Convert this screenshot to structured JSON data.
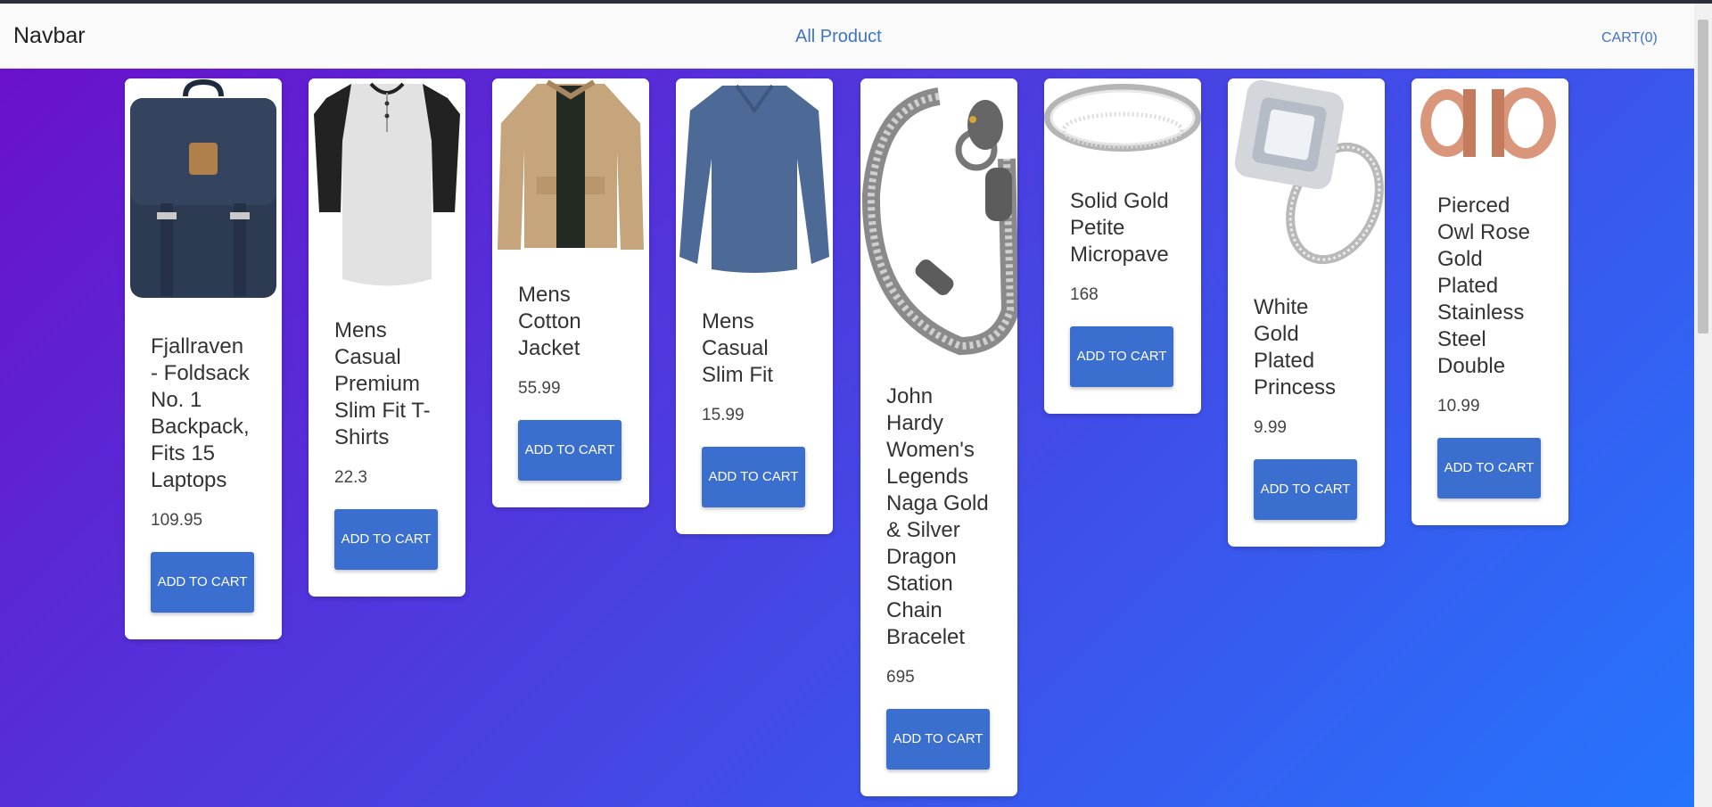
{
  "navbar": {
    "brand": "Navbar",
    "link": "All Product",
    "cart": "CART(0)"
  },
  "products": [
    {
      "title": "Fjallraven - Foldsack No. 1 Backpack, Fits 15 Laptops",
      "price": "109.95",
      "button": "ADD TO CART",
      "image_icon": "backpack-icon"
    },
    {
      "title": "Mens Casual Premium Slim Fit T-Shirts",
      "price": "22.3",
      "button": "ADD TO CART",
      "image_icon": "tshirt-icon"
    },
    {
      "title": "Mens Cotton Jacket",
      "price": "55.99",
      "button": "ADD TO CART",
      "image_icon": "jacket-icon"
    },
    {
      "title": "Mens Casual Slim Fit",
      "price": "15.99",
      "button": "ADD TO CART",
      "image_icon": "longsleeve-icon"
    },
    {
      "title": "John Hardy Women's Legends Naga Gold & Silver Dragon Station Chain Bracelet",
      "price": "695",
      "button": "ADD TO CART",
      "image_icon": "bracelet-icon"
    },
    {
      "title": "Solid Gold Petite Micropave",
      "price": "168",
      "button": "ADD TO CART",
      "image_icon": "ring-icon"
    },
    {
      "title": "White Gold Plated Princess",
      "price": "9.99",
      "button": "ADD TO CART",
      "image_icon": "diamond-ring-icon"
    },
    {
      "title": "Pierced Owl Rose Gold Plated Stainless Steel Double",
      "price": "10.99",
      "button": "ADD TO CART",
      "image_icon": "ear-plugs-icon"
    }
  ],
  "colors": {
    "accent": "#3b6fcf",
    "gradient_start": "#6a11cb",
    "gradient_end": "#2575fc"
  }
}
